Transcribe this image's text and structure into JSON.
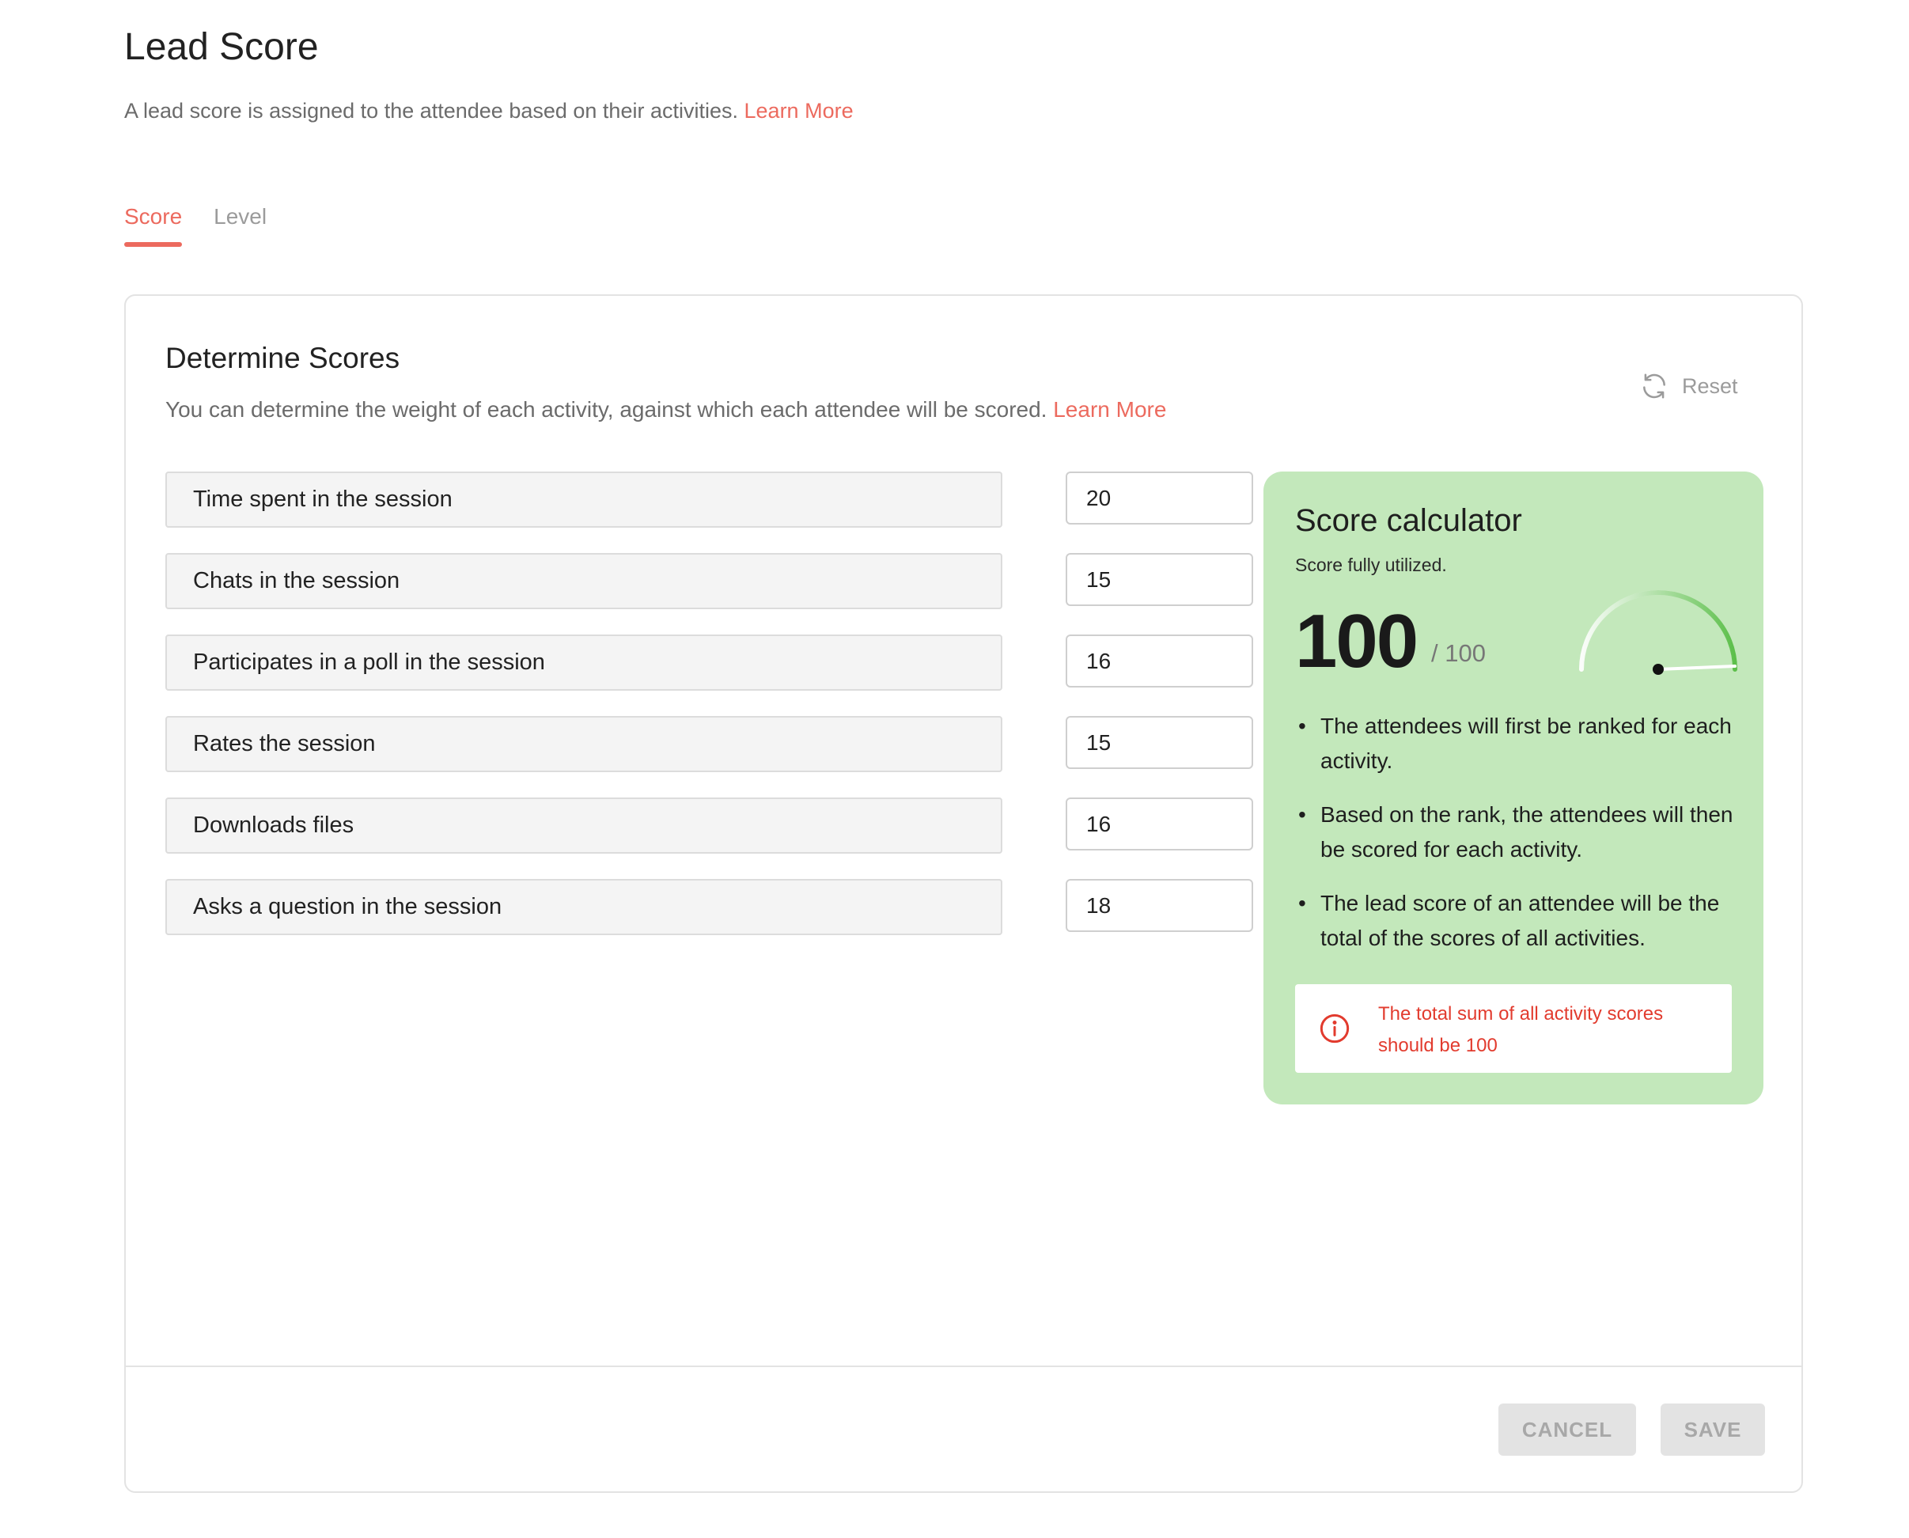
{
  "header": {
    "title": "Lead Score",
    "subtitle": "A lead score is assigned to the attendee based on their activities.",
    "learn_more": "Learn More"
  },
  "tabs": [
    {
      "label": "Score",
      "active": true
    },
    {
      "label": "Level",
      "active": false
    }
  ],
  "section": {
    "title": "Determine Scores",
    "description": "You can determine the weight of each activity, against which each attendee will be scored.",
    "learn_more": "Learn More",
    "reset_label": "Reset"
  },
  "activities": [
    {
      "label": "Time spent in the session",
      "value": "20"
    },
    {
      "label": "Chats in the session",
      "value": "15"
    },
    {
      "label": "Participates in a poll in the session",
      "value": "16"
    },
    {
      "label": "Rates the session",
      "value": "15"
    },
    {
      "label": "Downloads files",
      "value": "16"
    },
    {
      "label": "Asks a question in the session",
      "value": "18"
    }
  ],
  "calculator": {
    "title": "Score calculator",
    "status": "Score fully utilized.",
    "score": "100",
    "max": "/ 100",
    "gauge_fraction": 1.0,
    "bullets": [
      "The attendees will first be ranked for each activity.",
      "Based on the rank, the attendees will then be scored for each activity.",
      "The lead score of an attendee will be the total of the scores of all activities."
    ],
    "warning": "The total sum of all activity scores should be 100"
  },
  "footer": {
    "cancel_label": "CANCEL",
    "save_label": "SAVE"
  },
  "colors": {
    "accent": "#ec6a5e",
    "calculator_bg": "#c3e8bb",
    "gauge": "#5cbf4a",
    "warning": "#e23b2e"
  }
}
